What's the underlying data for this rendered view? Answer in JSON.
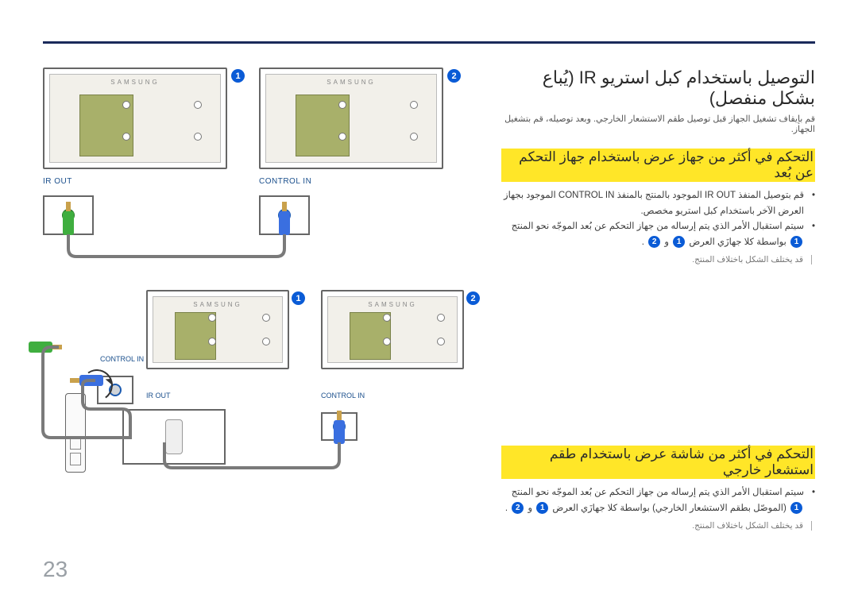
{
  "page_number": "23",
  "brand_text": "SAMSUNG",
  "title": "التوصيل باستخدام كبل استريو IR (يُباع بشكل منفصل)",
  "intro": "قم بإيقاف تشغيل الجهاز قبل توصيل طقم الاستشعار الخارجي. وبعد توصيله، قم بتشغيل الجهاز.",
  "section_a": {
    "heading": "التحكم في أكثر من جهاز عرض باستخدام جهاز التحكم عن بُعد",
    "b1_pre": "قم بتوصيل المنفذ ",
    "b1_irout": "IR OUT",
    "b1_mid": " الموجود بالمنتج بالمنفذ ",
    "b1_ctrlin": "CONTROL IN",
    "b1_post": " الموجود بجهاز العرض الآخر باستخدام كبل استريو مخصص.",
    "b2_pre": "سيتم استقبال الأمر الذي يتم إرساله من جهاز التحكم عن بُعد الموجّه نحو المنتج ",
    "b2_mid": " بواسطة كلا جهازَي العرض ",
    "b2_and": " و ",
    "b2_end": ".",
    "note": "قد يختلف الشكل باختلاف المنتج."
  },
  "section_b": {
    "heading": "التحكم في أكثر من شاشة عرض باستخدام طقم استشعار خارجي",
    "b1_pre": "سيتم استقبال الأمر الذي يتم إرساله من جهاز التحكم عن بُعد الموجّه نحو المنتج ",
    "b1_mid": " (الموصّل بطقم الاستشعار الخارجي) بواسطة كلا جهازَي العرض ",
    "b1_and": " و ",
    "b1_end": ".",
    "note": "قد يختلف الشكل باختلاف المنتج."
  },
  "labels": {
    "ir_out": "IR OUT",
    "control_in": "CONTROL IN"
  },
  "badges": {
    "one": "1",
    "two": "2"
  }
}
